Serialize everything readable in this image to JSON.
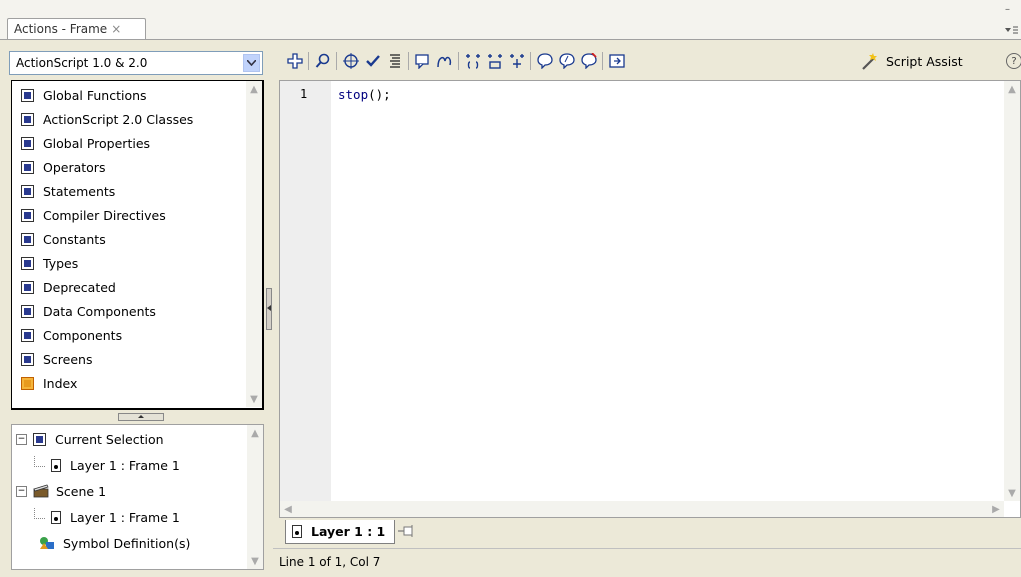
{
  "panel": {
    "tab_title": "Actions - Frame",
    "tab_close": "×"
  },
  "left": {
    "language_selected": "ActionScript 1.0 & 2.0",
    "toolbox_items": [
      {
        "label": "Global Functions",
        "icon": "book-icon"
      },
      {
        "label": "ActionScript 2.0 Classes",
        "icon": "book-icon"
      },
      {
        "label": "Global Properties",
        "icon": "book-icon"
      },
      {
        "label": "Operators",
        "icon": "book-icon"
      },
      {
        "label": "Statements",
        "icon": "book-icon"
      },
      {
        "label": "Compiler Directives",
        "icon": "book-icon"
      },
      {
        "label": "Constants",
        "icon": "book-icon"
      },
      {
        "label": "Types",
        "icon": "book-icon"
      },
      {
        "label": "Deprecated",
        "icon": "book-icon"
      },
      {
        "label": "Data Components",
        "icon": "book-icon"
      },
      {
        "label": "Components",
        "icon": "book-icon"
      },
      {
        "label": "Screens",
        "icon": "book-icon"
      },
      {
        "label": "Index",
        "icon": "index-book-icon"
      }
    ],
    "tree": {
      "current_selection": "Current Selection",
      "current_frame": "Layer 1 : Frame 1",
      "scene": "Scene 1",
      "scene_frame": "Layer 1 : Frame 1",
      "symbol_defs": "Symbol Definition(s)"
    }
  },
  "toolbar": {
    "script_assist_label": "Script Assist",
    "help": "?"
  },
  "editor": {
    "line_number": "1",
    "code_keyword": "stop",
    "code_rest": "();"
  },
  "footer": {
    "frame_tab": "Layer 1 : 1",
    "status": "Line 1 of 1, Col 7"
  },
  "colors": {
    "chrome": "#ece9d8",
    "code_keyword": "#00007f"
  }
}
